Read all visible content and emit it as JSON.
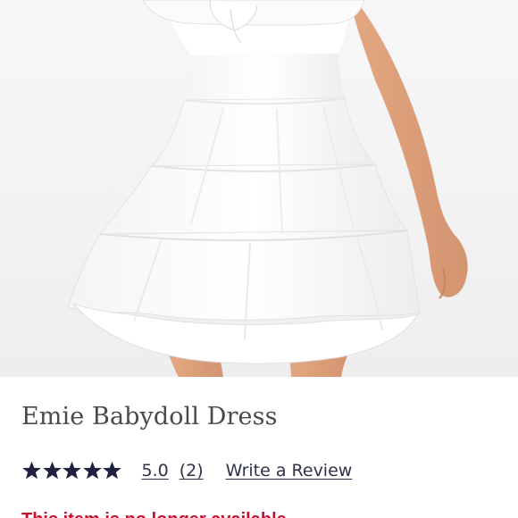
{
  "product": {
    "title": "Emie Babydoll Dress",
    "rating": {
      "stars": 5,
      "max_stars": 5,
      "value_text": "5.0",
      "count_text": "(2)",
      "write_review_label": "Write a Review",
      "star_color": "#1f2140"
    },
    "availability_text": "This item is no longer available",
    "availability_color": "#c8102e"
  },
  "icons": {
    "rating_star": "star-icon"
  }
}
